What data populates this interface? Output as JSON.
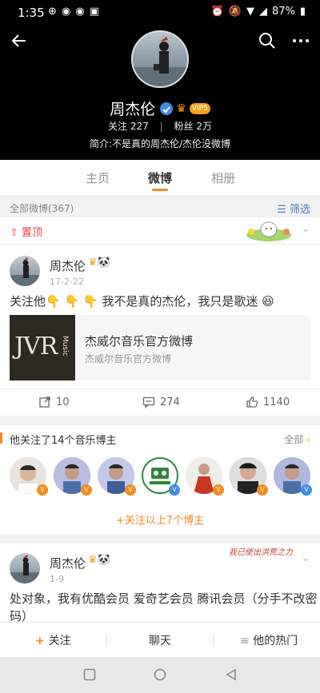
{
  "status_bar": {
    "time": "1:35",
    "battery": "87%"
  },
  "profile": {
    "name": "周杰伦",
    "vip": "VIP5",
    "following_label": "关注",
    "following_count": "227",
    "followers_label": "粉丝",
    "followers_count": "2万",
    "bio": "简介:不是真的周杰伦/杰伦没微博"
  },
  "tabs": [
    {
      "label": "主页"
    },
    {
      "label": "微博"
    },
    {
      "label": "相册"
    }
  ],
  "feed": {
    "count_label": "全部微博(367)",
    "filter_label": "筛选",
    "pinned_label": "置顶"
  },
  "post1": {
    "author": "周杰伦",
    "date": "17-2-22",
    "text": "关注他👇 👇 👇 我不是真的杰伦，我只是歌迷 😆",
    "share_title": "杰威尔音乐官方微博",
    "share_subtitle": "杰威尔音乐官方微博",
    "share_thumb_text": "JVR",
    "share_thumb_sub": "Music",
    "reposts": "10",
    "comments": "274",
    "likes": "1140"
  },
  "music": {
    "heading": "他关注了14个音乐博主",
    "all_label": "全部",
    "follow_all_label": "+关注以上7个博主",
    "avatars": [
      {
        "color": "#c9a78c"
      },
      {
        "color": "#9aa0c6"
      },
      {
        "color": "#a8b0d6"
      },
      {
        "color": "#2e8a3e"
      },
      {
        "color": "#c8361f"
      },
      {
        "color": "#3a3a3a"
      },
      {
        "color": "#8f97c7"
      }
    ]
  },
  "post2": {
    "author": "周杰伦",
    "date": "1-9",
    "sticker_text": "我已使出洪荒之力",
    "text_line1": "处对象，我有优酷会员 爱奇艺会员 腾讯会员（分手不改密",
    "text_line2": "码）"
  },
  "bottom_bar": {
    "follow_label": "关注",
    "chat_label": "聊天",
    "hot_label": "他的热门"
  },
  "colors": {
    "accent": "#f38b1f",
    "link": "#4a7cc0",
    "pin": "#e0443a"
  }
}
